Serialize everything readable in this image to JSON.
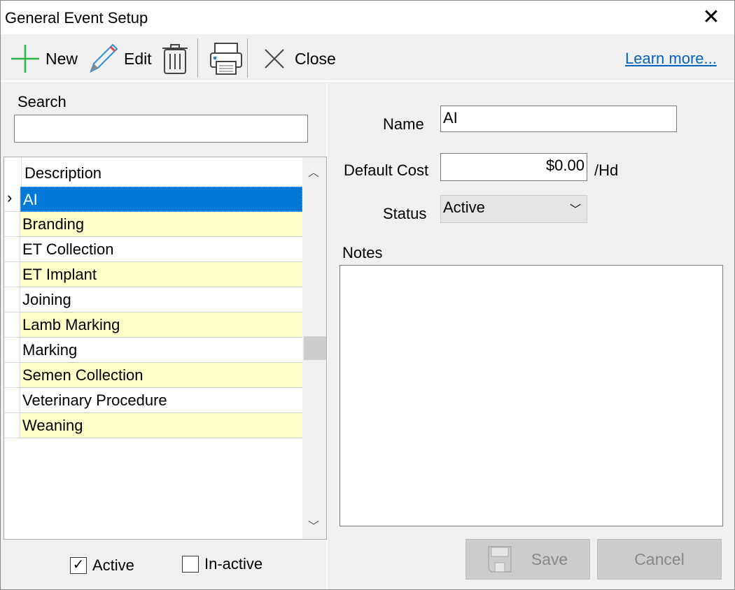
{
  "window": {
    "title": "General Event Setup",
    "close_glyph": "✕"
  },
  "toolbar": {
    "new_label": "New",
    "edit_label": "Edit",
    "close_label": "Close",
    "learn_more": "Learn more..."
  },
  "search": {
    "label": "Search",
    "value": "",
    "placeholder": ""
  },
  "grid": {
    "header": "Description",
    "selected_index": 0,
    "rows": [
      "AI",
      "Branding",
      "ET Collection",
      "ET Implant",
      "Joining",
      "Lamb Marking",
      "Marking",
      "Semen Collection",
      "Veterinary Procedure",
      "Weaning"
    ]
  },
  "filters": {
    "active_label": "Active",
    "active_checked": true,
    "inactive_label": "In-active",
    "inactive_checked": false
  },
  "form": {
    "name_label": "Name",
    "name_value": "AI",
    "cost_label": "Default Cost",
    "cost_value": "$0.00",
    "cost_unit": "/Hd",
    "status_label": "Status",
    "status_value": "Active",
    "notes_label": "Notes",
    "notes_value": ""
  },
  "buttons": {
    "save": "Save",
    "cancel": "Cancel"
  },
  "colors": {
    "selection": "#0078d7",
    "alt_row": "#ffffc9",
    "link": "#0563c1"
  }
}
